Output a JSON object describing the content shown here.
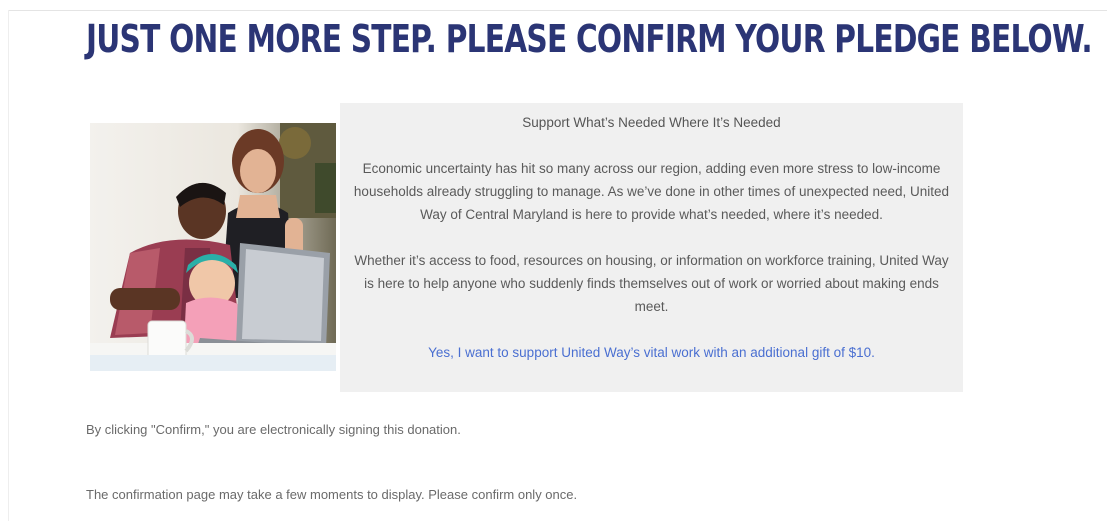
{
  "heading": "JUST ONE MORE STEP. PLEASE CONFIRM YOUR PLEDGE BELOW.",
  "promo": {
    "title": "Support What’s Needed Where It’s Needed",
    "paragraph1": "Economic uncertainty has hit so many across our region, adding even more stress to low-income households already struggling to manage. As we’ve done in other times of unexpected need, United Way of Central Maryland is here to provide what’s needed, where it’s needed.",
    "paragraph2": "Whether it’s access to food, resources on housing, or information on workforce training, United Way is here to help anyone who suddenly finds themselves out of work or worried about making ends meet.",
    "link": "Yes, I want to support United Way’s vital work with an additional gift of $10."
  },
  "notes": {
    "sign": "By clicking \"Confirm,\" you are electronically signing this donation.",
    "confirm": "The confirmation page may take a few moments to display. Please confirm only once."
  },
  "colors": {
    "heading": "#2b3575",
    "link": "#4a6fd1",
    "promo_background": "#f0f0f0"
  }
}
